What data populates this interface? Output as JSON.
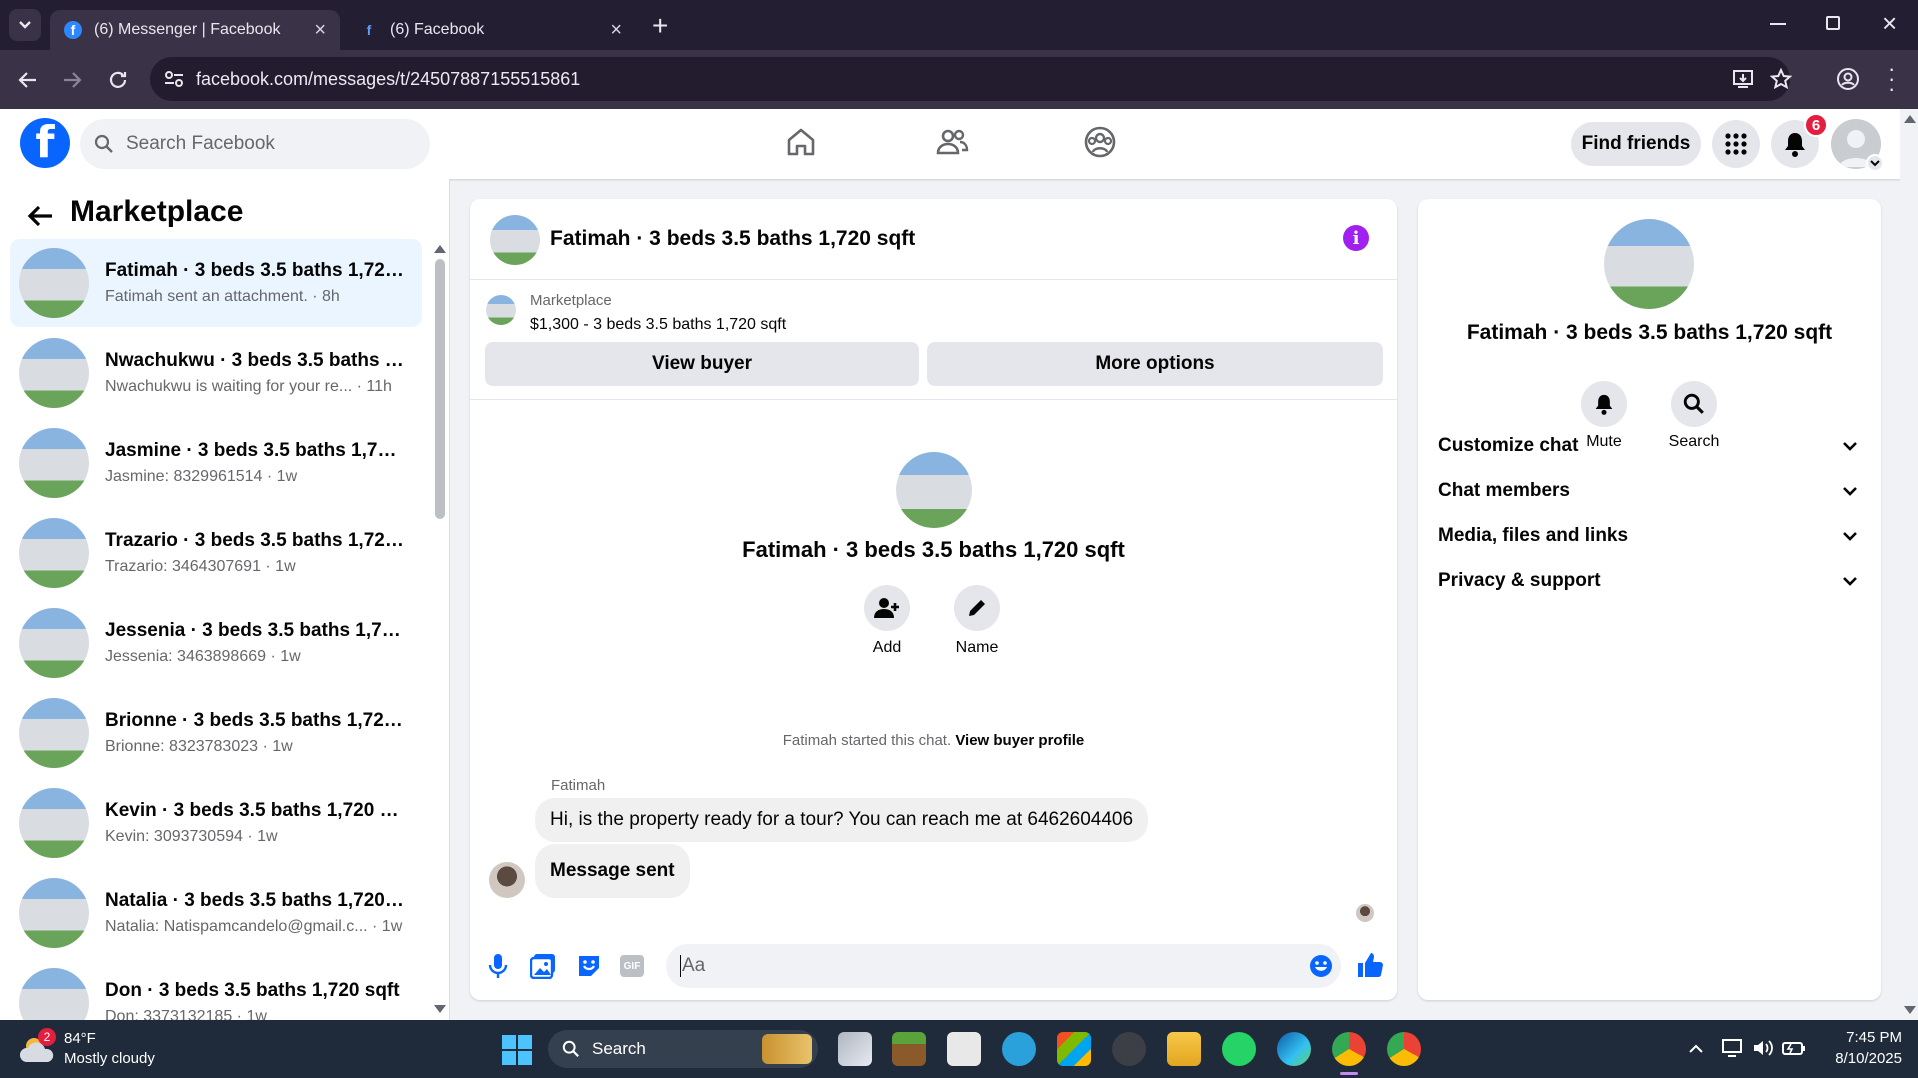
{
  "browser": {
    "tabs": [
      {
        "title": "(6) Messenger | Facebook",
        "active": true
      },
      {
        "title": "(6) Facebook",
        "active": false
      }
    ],
    "url": "facebook.com/messages/t/24507887155515861"
  },
  "header": {
    "search_placeholder": "Search Facebook",
    "find_friends": "Find friends",
    "notification_count": "6"
  },
  "sidebar": {
    "title": "Marketplace",
    "conversations": [
      {
        "name": "Fatimah · 3 beds 3.5 baths 1,720 ...",
        "preview": "Fatimah sent an attachment. · 8h",
        "active": true
      },
      {
        "name": "Nwachukwu · 3 beds 3.5 baths 1,...",
        "preview": "Nwachukwu is waiting for your re...  · 11h"
      },
      {
        "name": "Jasmine · 3 beds 3.5 baths 1,720 ...",
        "preview": "Jasmine: 8329961514 · 1w"
      },
      {
        "name": "Trazario · 3 beds 3.5 baths 1,720 ...",
        "preview": "Trazario: 3464307691 · 1w"
      },
      {
        "name": "Jessenia · 3 beds 3.5 baths 1,720 ...",
        "preview": "Jessenia: 3463898669 · 1w"
      },
      {
        "name": "Brionne · 3 beds 3.5 baths 1,720 ...",
        "preview": "Brionne: 8323783023 · 1w"
      },
      {
        "name": "Kevin · 3 beds 3.5 baths 1,720 sqft",
        "preview": "Kevin: 3093730594 · 1w"
      },
      {
        "name": "Natalia · 3 beds 3.5 baths 1,720 s...",
        "preview": "Natalia: Natispamcandelo@gmail.c... · 1w"
      },
      {
        "name": "Don · 3 beds 3.5 baths 1,720 sqft",
        "preview": "Don: 3373132185 · 1w"
      }
    ]
  },
  "chat": {
    "title": "Fatimah · 3 beds 3.5 baths 1,720 sqft",
    "marketplace_label": "Marketplace",
    "listing": "$1,300 - 3 beds 3.5 baths 1,720 sqft",
    "view_buyer": "View buyer",
    "more_options": "More options",
    "add_label": "Add",
    "name_label": "Name",
    "started_text": "Fatimah started this chat.",
    "view_buyer_profile": "View buyer profile",
    "sender": "Fatimah",
    "messages": [
      "Hi, is the property ready for a tour? You can reach me at 6462604406",
      "Message sent"
    ],
    "composer_placeholder": "Aa"
  },
  "details": {
    "name": "Fatimah · 3 beds 3.5 baths 1,720 sqft",
    "mute": "Mute",
    "search": "Search",
    "sections": [
      "Customize chat",
      "Chat members",
      "Media, files and links",
      "Privacy & support"
    ]
  },
  "taskbar": {
    "weather_temp": "84°F",
    "weather_desc": "Mostly cloudy",
    "weather_badge": "2",
    "search": "Search",
    "time": "7:45 PM",
    "date": "8/10/2025"
  }
}
